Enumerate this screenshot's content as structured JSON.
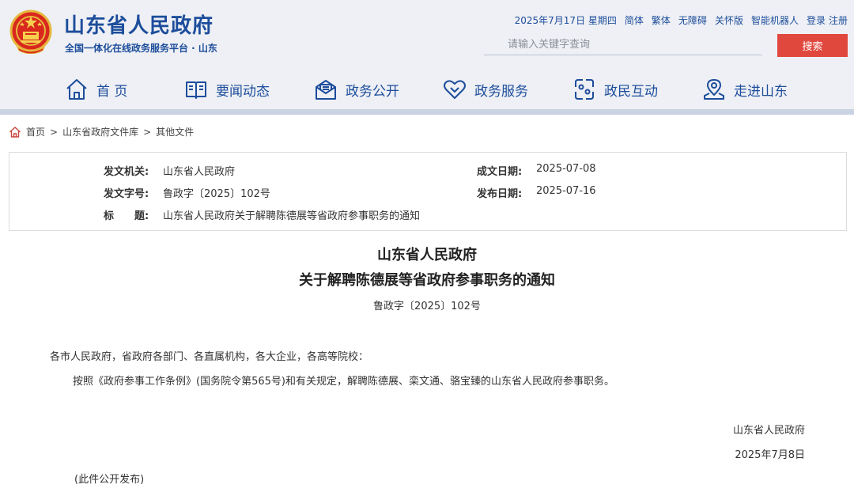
{
  "header": {
    "site_title": "山东省人民政府",
    "site_subtitle": "全国一体化在线政务服务平台 · 山东",
    "date": "2025年7月17日 星期四",
    "links": [
      "简体",
      "繁体",
      "无障碍",
      "关怀版",
      "智能机器人"
    ],
    "login": "登录",
    "register": "注册",
    "search_placeholder": "请输入关键字查询",
    "search_button": "搜索",
    "brand_color": "#1d4d9b",
    "accent_color": "#e0483e"
  },
  "nav": [
    {
      "label": "首 页",
      "icon": "home-icon"
    },
    {
      "label": "要闻动态",
      "icon": "book-icon"
    },
    {
      "label": "政务公开",
      "icon": "mail-icon"
    },
    {
      "label": "政务服务",
      "icon": "heart-icon"
    },
    {
      "label": "政民互动",
      "icon": "interaction-icon"
    },
    {
      "label": "走进山东",
      "icon": "location-icon"
    }
  ],
  "breadcrumb": [
    "首页",
    "山东省政府文件库",
    "其他文件"
  ],
  "info": {
    "issuer_label": "发文机关:",
    "issuer": "山东省人民政府",
    "doc_number_label": "发文字号:",
    "doc_number": "鲁政字〔2025〕102号",
    "title_label": "标　　题:",
    "title": "山东省人民政府关于解聘陈德展等省政府参事职务的通知",
    "written_date_label": "成文日期:",
    "written_date": "2025-07-08",
    "publish_date_label": "发布日期:",
    "publish_date": "2025-07-16"
  },
  "document": {
    "title_line1": "山东省人民政府",
    "title_line2": "关于解聘陈德展等省政府参事职务的通知",
    "number": "鲁政字〔2025〕102号",
    "addressee": "各市人民政府，省政府各部门、各直属机构，各大企业，各高等院校：",
    "body": "按照《政府参事工作条例》(国务院令第565号)和有关规定，解聘陈德展、栾文通、骆宝臻的山东省人民政府参事职务。",
    "signature": "山东省人民政府",
    "sign_date": "2025年7月8日",
    "note": "(此件公开发布)"
  }
}
